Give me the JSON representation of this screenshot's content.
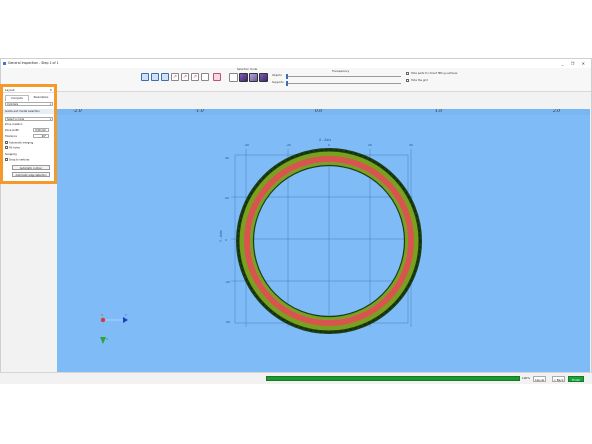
{
  "window": {
    "title": "General Inspection - Step 1 of 1",
    "controls": "_ ❐ ✕"
  },
  "toolbar": {
    "selection_mode_label": "Selection mode",
    "transparency_label": "Transparency",
    "objects_label": "Objects",
    "supports_label": "Supports",
    "hide_parts_label": "Hide parts for direct fitting surfaces",
    "hide_grid_label": "Hide the grid",
    "icons": [
      "undo-icon",
      "redo-icon",
      "axis-icon",
      "move-icon",
      "pen-icon",
      "select-cube-icon"
    ]
  },
  "panel": {
    "title": "Layout",
    "close": "✕",
    "tabs": [
      "Compute",
      "Parameters"
    ],
    "preset": "Cylinders",
    "section_title": "Guide and model selection",
    "mode_select": "Select a mode",
    "zone_creation_label": "Zone creation",
    "zone_width_label": "Zone width",
    "zone_width_value": "0.50 mm",
    "tolerance_label": "Tolerance",
    "tolerance_value": "20°",
    "automatic_merging": "Automatic merging",
    "fill_holes": "Fill holes",
    "snapping_label": "Snapping",
    "snap_to_vertices": "Snap to vertices",
    "auto_contour_btn": "Automatic contour computation",
    "auto_edge_btn": "Automatic edge detection"
  },
  "viewport": {
    "ruler_labels": [
      "-2.0",
      "-1.0",
      "0.0",
      "1.0",
      "2.0"
    ],
    "x_axis_title": "X - Axis",
    "y_axis_title": "Y - Axis",
    "x_ticks": [
      "-40",
      "-20",
      "0",
      "20",
      "40"
    ],
    "y_ticks": [
      "40",
      "20",
      "0",
      "-20",
      "-40"
    ],
    "triad_labels": [
      "X",
      "Y",
      "Z"
    ]
  },
  "status": {
    "progress_pct": 100,
    "progress_text": "100%",
    "cancel": "Cancel",
    "back": "< Back",
    "finish": "Finish"
  },
  "colors": {
    "viewport_bg": "#7fbbf7",
    "panel_highlight": "#f39a2b",
    "ring_red": "#d9534f",
    "ring_green": "#2f7a2f",
    "progress": "#1c9a2e"
  }
}
